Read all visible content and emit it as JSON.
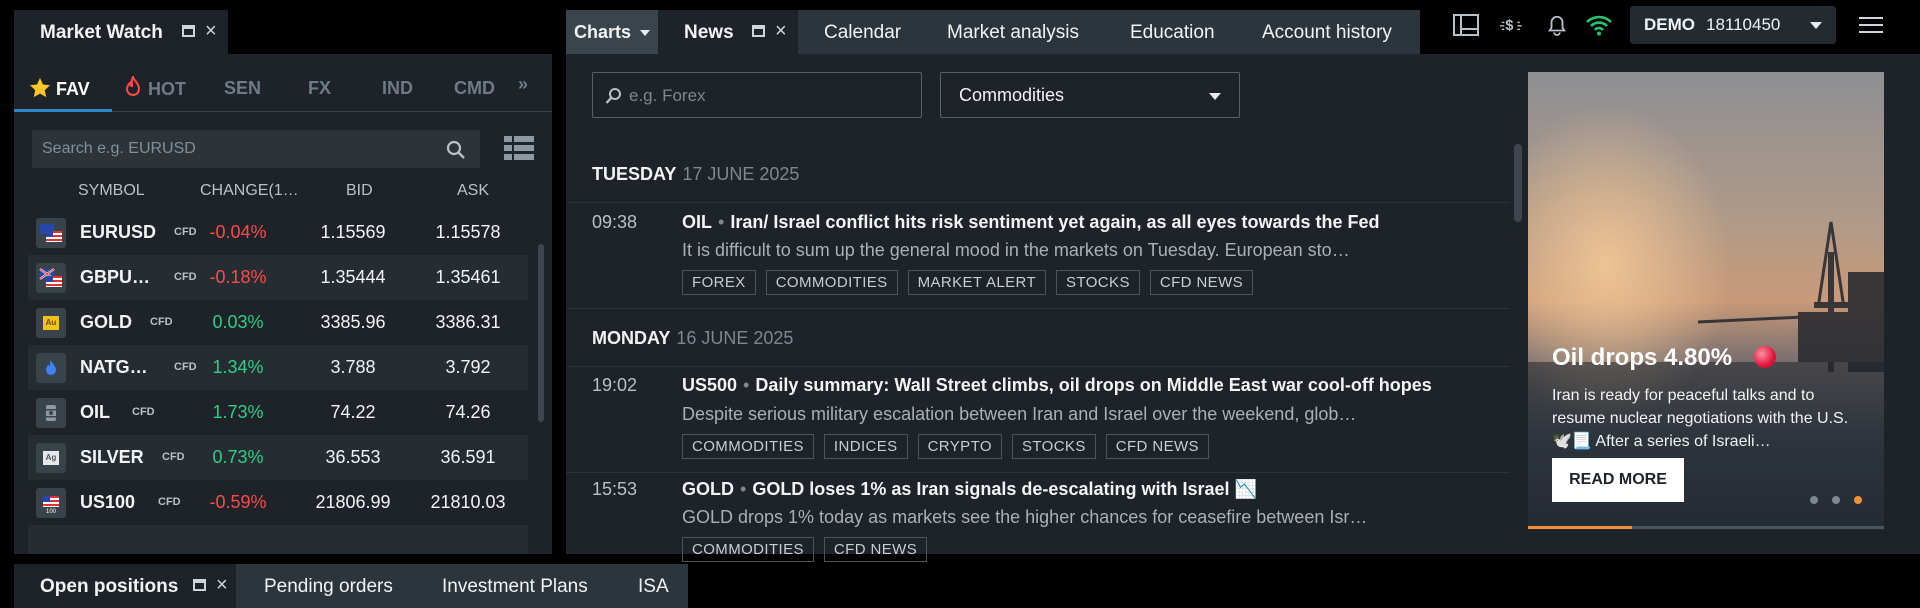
{
  "market_watch": {
    "title": "Market Watch",
    "categories": [
      {
        "label": "FAV",
        "icon": "star-icon"
      },
      {
        "label": "HOT",
        "icon": "flame-icon"
      },
      {
        "label": "SEN"
      },
      {
        "label": "FX"
      },
      {
        "label": "IND"
      },
      {
        "label": "CMD"
      }
    ],
    "search_placeholder": "Search e.g. EURUSD",
    "columns": {
      "symbol": "SYMBOL",
      "change": "CHANGE(1…",
      "bid": "BID",
      "ask": "ASK"
    },
    "rows": [
      {
        "symbol": "EURUSD",
        "tag": "CFD",
        "change": "-0.04%",
        "bid": "1.15569",
        "ask": "1.15578",
        "dir": "neg"
      },
      {
        "symbol": "GBPU…",
        "tag": "CFD",
        "change": "-0.18%",
        "bid": "1.35444",
        "ask": "1.35461",
        "dir": "neg"
      },
      {
        "symbol": "GOLD",
        "tag": "CFD",
        "change": "0.03%",
        "bid": "3385.96",
        "ask": "3386.31",
        "dir": "pos"
      },
      {
        "symbol": "NATG…",
        "tag": "CFD",
        "change": "1.34%",
        "bid": "3.788",
        "ask": "3.792",
        "dir": "pos"
      },
      {
        "symbol": "OIL",
        "tag": "CFD",
        "change": "1.73%",
        "bid": "74.22",
        "ask": "74.26",
        "dir": "pos"
      },
      {
        "symbol": "SILVER",
        "tag": "CFD",
        "change": "0.73%",
        "bid": "36.553",
        "ask": "36.591",
        "dir": "pos"
      },
      {
        "symbol": "US100",
        "tag": "CFD",
        "change": "-0.59%",
        "bid": "21806.99",
        "ask": "21810.03",
        "dir": "neg"
      }
    ],
    "gold_icon_text": "Au",
    "silver_icon_text": "Ag",
    "us100_icon_text": "100"
  },
  "top_tabs": {
    "charts": "Charts",
    "news": "News",
    "others": [
      "Calendar",
      "Market analysis",
      "Education",
      "Account history"
    ]
  },
  "account": {
    "mode": "DEMO",
    "number": "18110450"
  },
  "news": {
    "search_placeholder": "e.g. Forex",
    "filter_value": "Commodities",
    "days": [
      {
        "day": "TUESDAY",
        "date": "17 JUNE 2025"
      },
      {
        "day": "MONDAY",
        "date": "16 JUNE 2025"
      }
    ],
    "items": [
      {
        "time": "09:38",
        "symbol": "OIL",
        "title": "Iran/ Israel conflict hits risk sentiment yet again, as all eyes towards the Fed",
        "summary": "It is difficult to sum up the general mood in the markets on Tuesday. European sto…",
        "tags": [
          "FOREX",
          "COMMODITIES",
          "MARKET ALERT",
          "STOCKS",
          "CFD NEWS"
        ]
      },
      {
        "time": "19:02",
        "symbol": "US500",
        "title": "Daily summary: Wall Street climbs, oil drops on Middle East war cool-off hopes",
        "summary": "Despite serious military escalation between Iran and Israel over the weekend, glob…",
        "tags": [
          "COMMODITIES",
          "INDICES",
          "CRYPTO",
          "STOCKS",
          "CFD NEWS"
        ]
      },
      {
        "time": "15:53",
        "symbol": "GOLD",
        "title": "GOLD loses 1% as Iran signals de-escalating with Israel 📉",
        "summary": "GOLD drops 1% today as markets see the higher chances for ceasefire between Isr…",
        "tags": [
          "COMMODITIES",
          "CFD NEWS"
        ]
      }
    ]
  },
  "promo": {
    "title": "Oil drops 4.80%",
    "body": "Iran is ready for peaceful talks and to resume nuclear negotiations with the U.S. 🕊️📃 After a series of Israeli…",
    "button": "READ MORE",
    "slide_count": 3,
    "active_slide": 3
  },
  "bottom_tabs": {
    "open_positions": "Open positions",
    "others": [
      "Pending orders",
      "Investment Plans",
      "ISA"
    ]
  },
  "colors": {
    "negative": "#ff4a4a",
    "positive": "#2fcf86",
    "accent": "#2e87c8",
    "wifi": "#27c36b",
    "progress": "#f0913a"
  }
}
